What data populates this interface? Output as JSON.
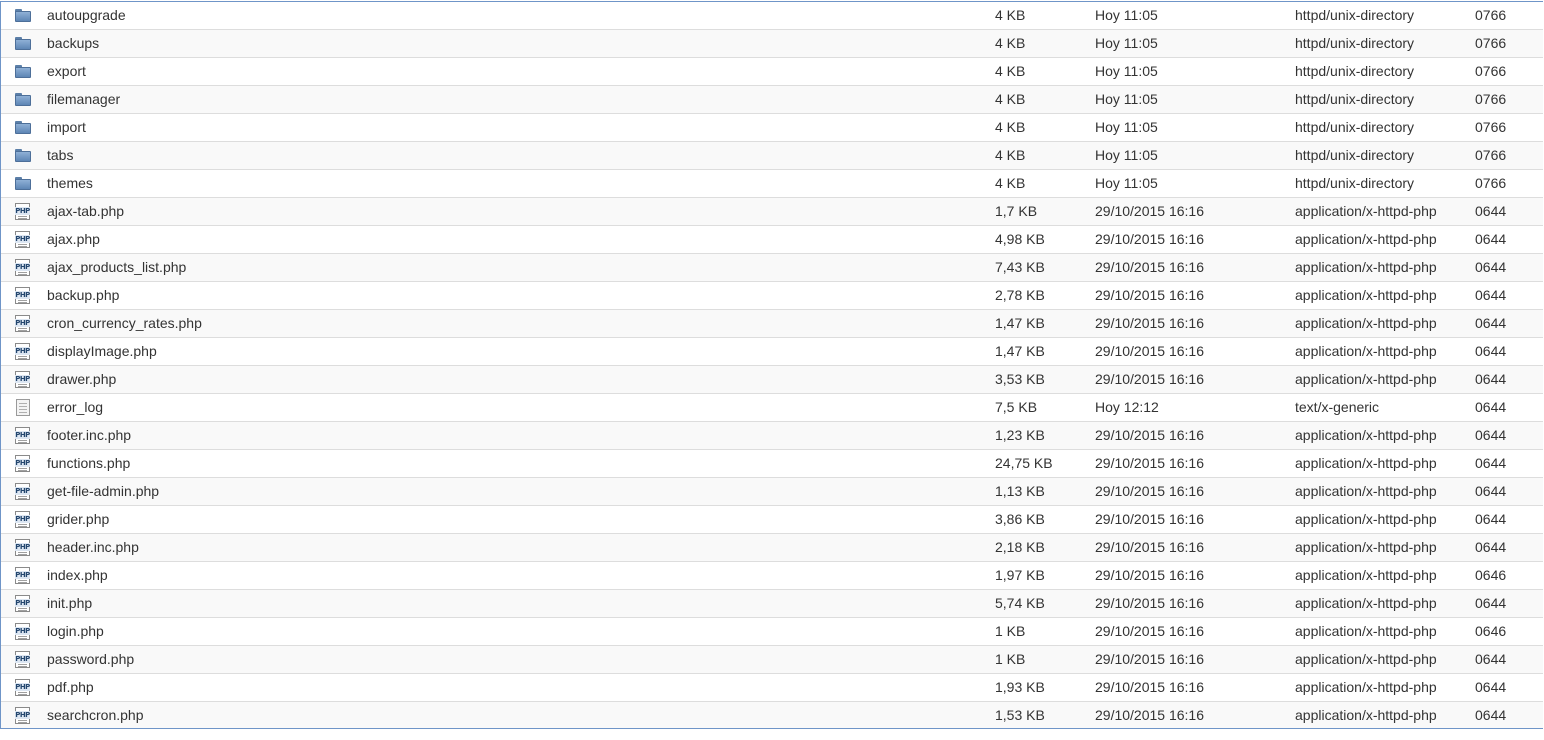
{
  "file_list": {
    "rows": [
      {
        "kind": "folder",
        "icon": "folder-icon",
        "name": "autoupgrade",
        "size": "4 KB",
        "date": "Hoy 11:05",
        "type": "httpd/unix-directory",
        "perms": "0766"
      },
      {
        "kind": "folder",
        "icon": "folder-icon",
        "name": "backups",
        "size": "4 KB",
        "date": "Hoy 11:05",
        "type": "httpd/unix-directory",
        "perms": "0766"
      },
      {
        "kind": "folder",
        "icon": "folder-icon",
        "name": "export",
        "size": "4 KB",
        "date": "Hoy 11:05",
        "type": "httpd/unix-directory",
        "perms": "0766"
      },
      {
        "kind": "folder",
        "icon": "folder-icon",
        "name": "filemanager",
        "size": "4 KB",
        "date": "Hoy 11:05",
        "type": "httpd/unix-directory",
        "perms": "0766"
      },
      {
        "kind": "folder",
        "icon": "folder-icon",
        "name": "import",
        "size": "4 KB",
        "date": "Hoy 11:05",
        "type": "httpd/unix-directory",
        "perms": "0766"
      },
      {
        "kind": "folder",
        "icon": "folder-icon",
        "name": "tabs",
        "size": "4 KB",
        "date": "Hoy 11:05",
        "type": "httpd/unix-directory",
        "perms": "0766"
      },
      {
        "kind": "folder",
        "icon": "folder-icon",
        "name": "themes",
        "size": "4 KB",
        "date": "Hoy 11:05",
        "type": "httpd/unix-directory",
        "perms": "0766"
      },
      {
        "kind": "php",
        "icon": "php-file-icon",
        "name": "ajax-tab.php",
        "size": "1,7 KB",
        "date": "29/10/2015 16:16",
        "type": "application/x-httpd-php",
        "perms": "0644"
      },
      {
        "kind": "php",
        "icon": "php-file-icon",
        "name": "ajax.php",
        "size": "4,98 KB",
        "date": "29/10/2015 16:16",
        "type": "application/x-httpd-php",
        "perms": "0644"
      },
      {
        "kind": "php",
        "icon": "php-file-icon",
        "name": "ajax_products_list.php",
        "size": "7,43 KB",
        "date": "29/10/2015 16:16",
        "type": "application/x-httpd-php",
        "perms": "0644"
      },
      {
        "kind": "php",
        "icon": "php-file-icon",
        "name": "backup.php",
        "size": "2,78 KB",
        "date": "29/10/2015 16:16",
        "type": "application/x-httpd-php",
        "perms": "0644"
      },
      {
        "kind": "php",
        "icon": "php-file-icon",
        "name": "cron_currency_rates.php",
        "size": "1,47 KB",
        "date": "29/10/2015 16:16",
        "type": "application/x-httpd-php",
        "perms": "0644"
      },
      {
        "kind": "php",
        "icon": "php-file-icon",
        "name": "displayImage.php",
        "size": "1,47 KB",
        "date": "29/10/2015 16:16",
        "type": "application/x-httpd-php",
        "perms": "0644"
      },
      {
        "kind": "php",
        "icon": "php-file-icon",
        "name": "drawer.php",
        "size": "3,53 KB",
        "date": "29/10/2015 16:16",
        "type": "application/x-httpd-php",
        "perms": "0644"
      },
      {
        "kind": "text",
        "icon": "text-file-icon",
        "name": "error_log",
        "size": "7,5 KB",
        "date": "Hoy 12:12",
        "type": "text/x-generic",
        "perms": "0644"
      },
      {
        "kind": "php",
        "icon": "php-file-icon",
        "name": "footer.inc.php",
        "size": "1,23 KB",
        "date": "29/10/2015 16:16",
        "type": "application/x-httpd-php",
        "perms": "0644"
      },
      {
        "kind": "php",
        "icon": "php-file-icon",
        "name": "functions.php",
        "size": "24,75 KB",
        "date": "29/10/2015 16:16",
        "type": "application/x-httpd-php",
        "perms": "0644"
      },
      {
        "kind": "php",
        "icon": "php-file-icon",
        "name": "get-file-admin.php",
        "size": "1,13 KB",
        "date": "29/10/2015 16:16",
        "type": "application/x-httpd-php",
        "perms": "0644"
      },
      {
        "kind": "php",
        "icon": "php-file-icon",
        "name": "grider.php",
        "size": "3,86 KB",
        "date": "29/10/2015 16:16",
        "type": "application/x-httpd-php",
        "perms": "0644"
      },
      {
        "kind": "php",
        "icon": "php-file-icon",
        "name": "header.inc.php",
        "size": "2,18 KB",
        "date": "29/10/2015 16:16",
        "type": "application/x-httpd-php",
        "perms": "0644"
      },
      {
        "kind": "php",
        "icon": "php-file-icon",
        "name": "index.php",
        "size": "1,97 KB",
        "date": "29/10/2015 16:16",
        "type": "application/x-httpd-php",
        "perms": "0646"
      },
      {
        "kind": "php",
        "icon": "php-file-icon",
        "name": "init.php",
        "size": "5,74 KB",
        "date": "29/10/2015 16:16",
        "type": "application/x-httpd-php",
        "perms": "0644"
      },
      {
        "kind": "php",
        "icon": "php-file-icon",
        "name": "login.php",
        "size": "1 KB",
        "date": "29/10/2015 16:16",
        "type": "application/x-httpd-php",
        "perms": "0646"
      },
      {
        "kind": "php",
        "icon": "php-file-icon",
        "name": "password.php",
        "size": "1 KB",
        "date": "29/10/2015 16:16",
        "type": "application/x-httpd-php",
        "perms": "0644"
      },
      {
        "kind": "php",
        "icon": "php-file-icon",
        "name": "pdf.php",
        "size": "1,93 KB",
        "date": "29/10/2015 16:16",
        "type": "application/x-httpd-php",
        "perms": "0644"
      },
      {
        "kind": "php",
        "icon": "php-file-icon",
        "name": "searchcron.php",
        "size": "1,53 KB",
        "date": "29/10/2015 16:16",
        "type": "application/x-httpd-php",
        "perms": "0644"
      }
    ]
  },
  "icons": {
    "php_label": "PHP"
  },
  "colors": {
    "frame_border": "#6f95c8",
    "row_divider": "#dddddd",
    "row_alt": "#f9f9f9",
    "text": "#333333",
    "folder": "#6f93c0"
  }
}
